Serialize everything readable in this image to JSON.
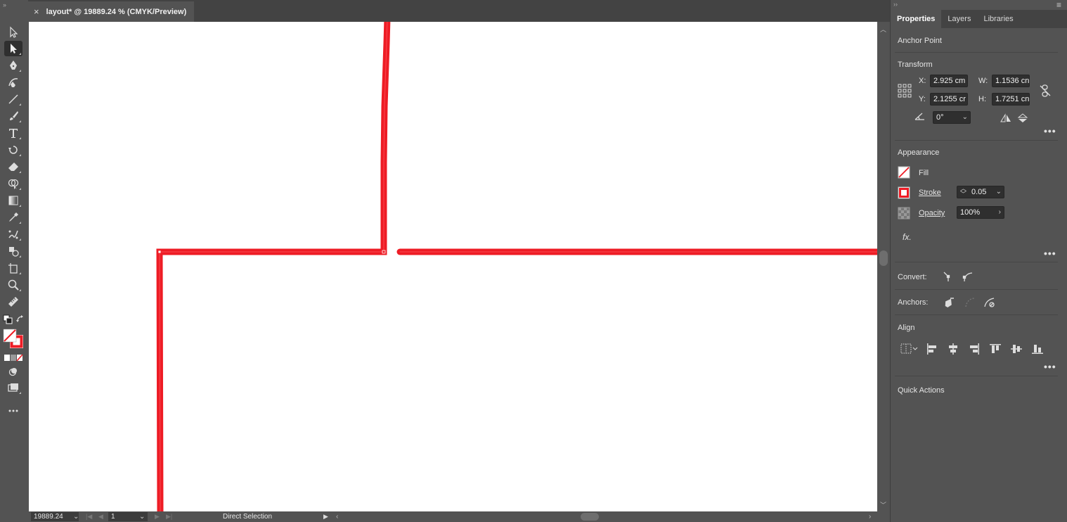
{
  "document": {
    "tab_title": "layout* @ 19889.24 % (CMYK/Preview)",
    "close_glyph": "×"
  },
  "statusbar": {
    "zoom": "19889.24",
    "page": "1",
    "tool_name": "Direct Selection"
  },
  "panel": {
    "tabs": [
      "Properties",
      "Layers",
      "Libraries"
    ],
    "active_tab": "Properties",
    "selection_type": "Anchor Point",
    "transform": {
      "title": "Transform",
      "x_label": "X:",
      "x_value": "2.925 cm",
      "y_label": "Y:",
      "y_value": "2.1255 cr",
      "w_label": "W:",
      "w_value": "1.1536 cn",
      "h_label": "H:",
      "h_value": "1.7251 cn",
      "rotate_value": "0°"
    },
    "appearance": {
      "title": "Appearance",
      "fill_label": "Fill",
      "stroke_label": "Stroke",
      "stroke_value": "0.05",
      "opacity_label": "Opacity",
      "opacity_value": "100%",
      "fx_label": "fx."
    },
    "convert_label": "Convert:",
    "anchors_label": "Anchors:",
    "align_title": "Align",
    "quick_actions_title": "Quick Actions"
  },
  "colors": {
    "stroke_red": "#ee1c25",
    "ui_dark": "#535353",
    "ui_darker": "#434343",
    "field_bg": "#2f2f2f"
  },
  "icons": {
    "tools": [
      "selection-arrow-icon",
      "direct-selection-icon",
      "pen-icon",
      "curvature-icon",
      "line-segment-icon",
      "paintbrush-icon",
      "type-icon",
      "rotate-icon",
      "eraser-icon",
      "shape-builder-icon",
      "gradient-icon",
      "eyedropper-icon",
      "puppet-warp-icon",
      "symbol-sprayer-icon",
      "artboard-icon",
      "zoom-icon",
      "ruler-icon",
      "swap-colors-icon",
      "fill-stroke-icon",
      "color-mode-icon",
      "draw-mode-icon",
      "screen-mode-icon",
      "more-tools-icon"
    ]
  }
}
